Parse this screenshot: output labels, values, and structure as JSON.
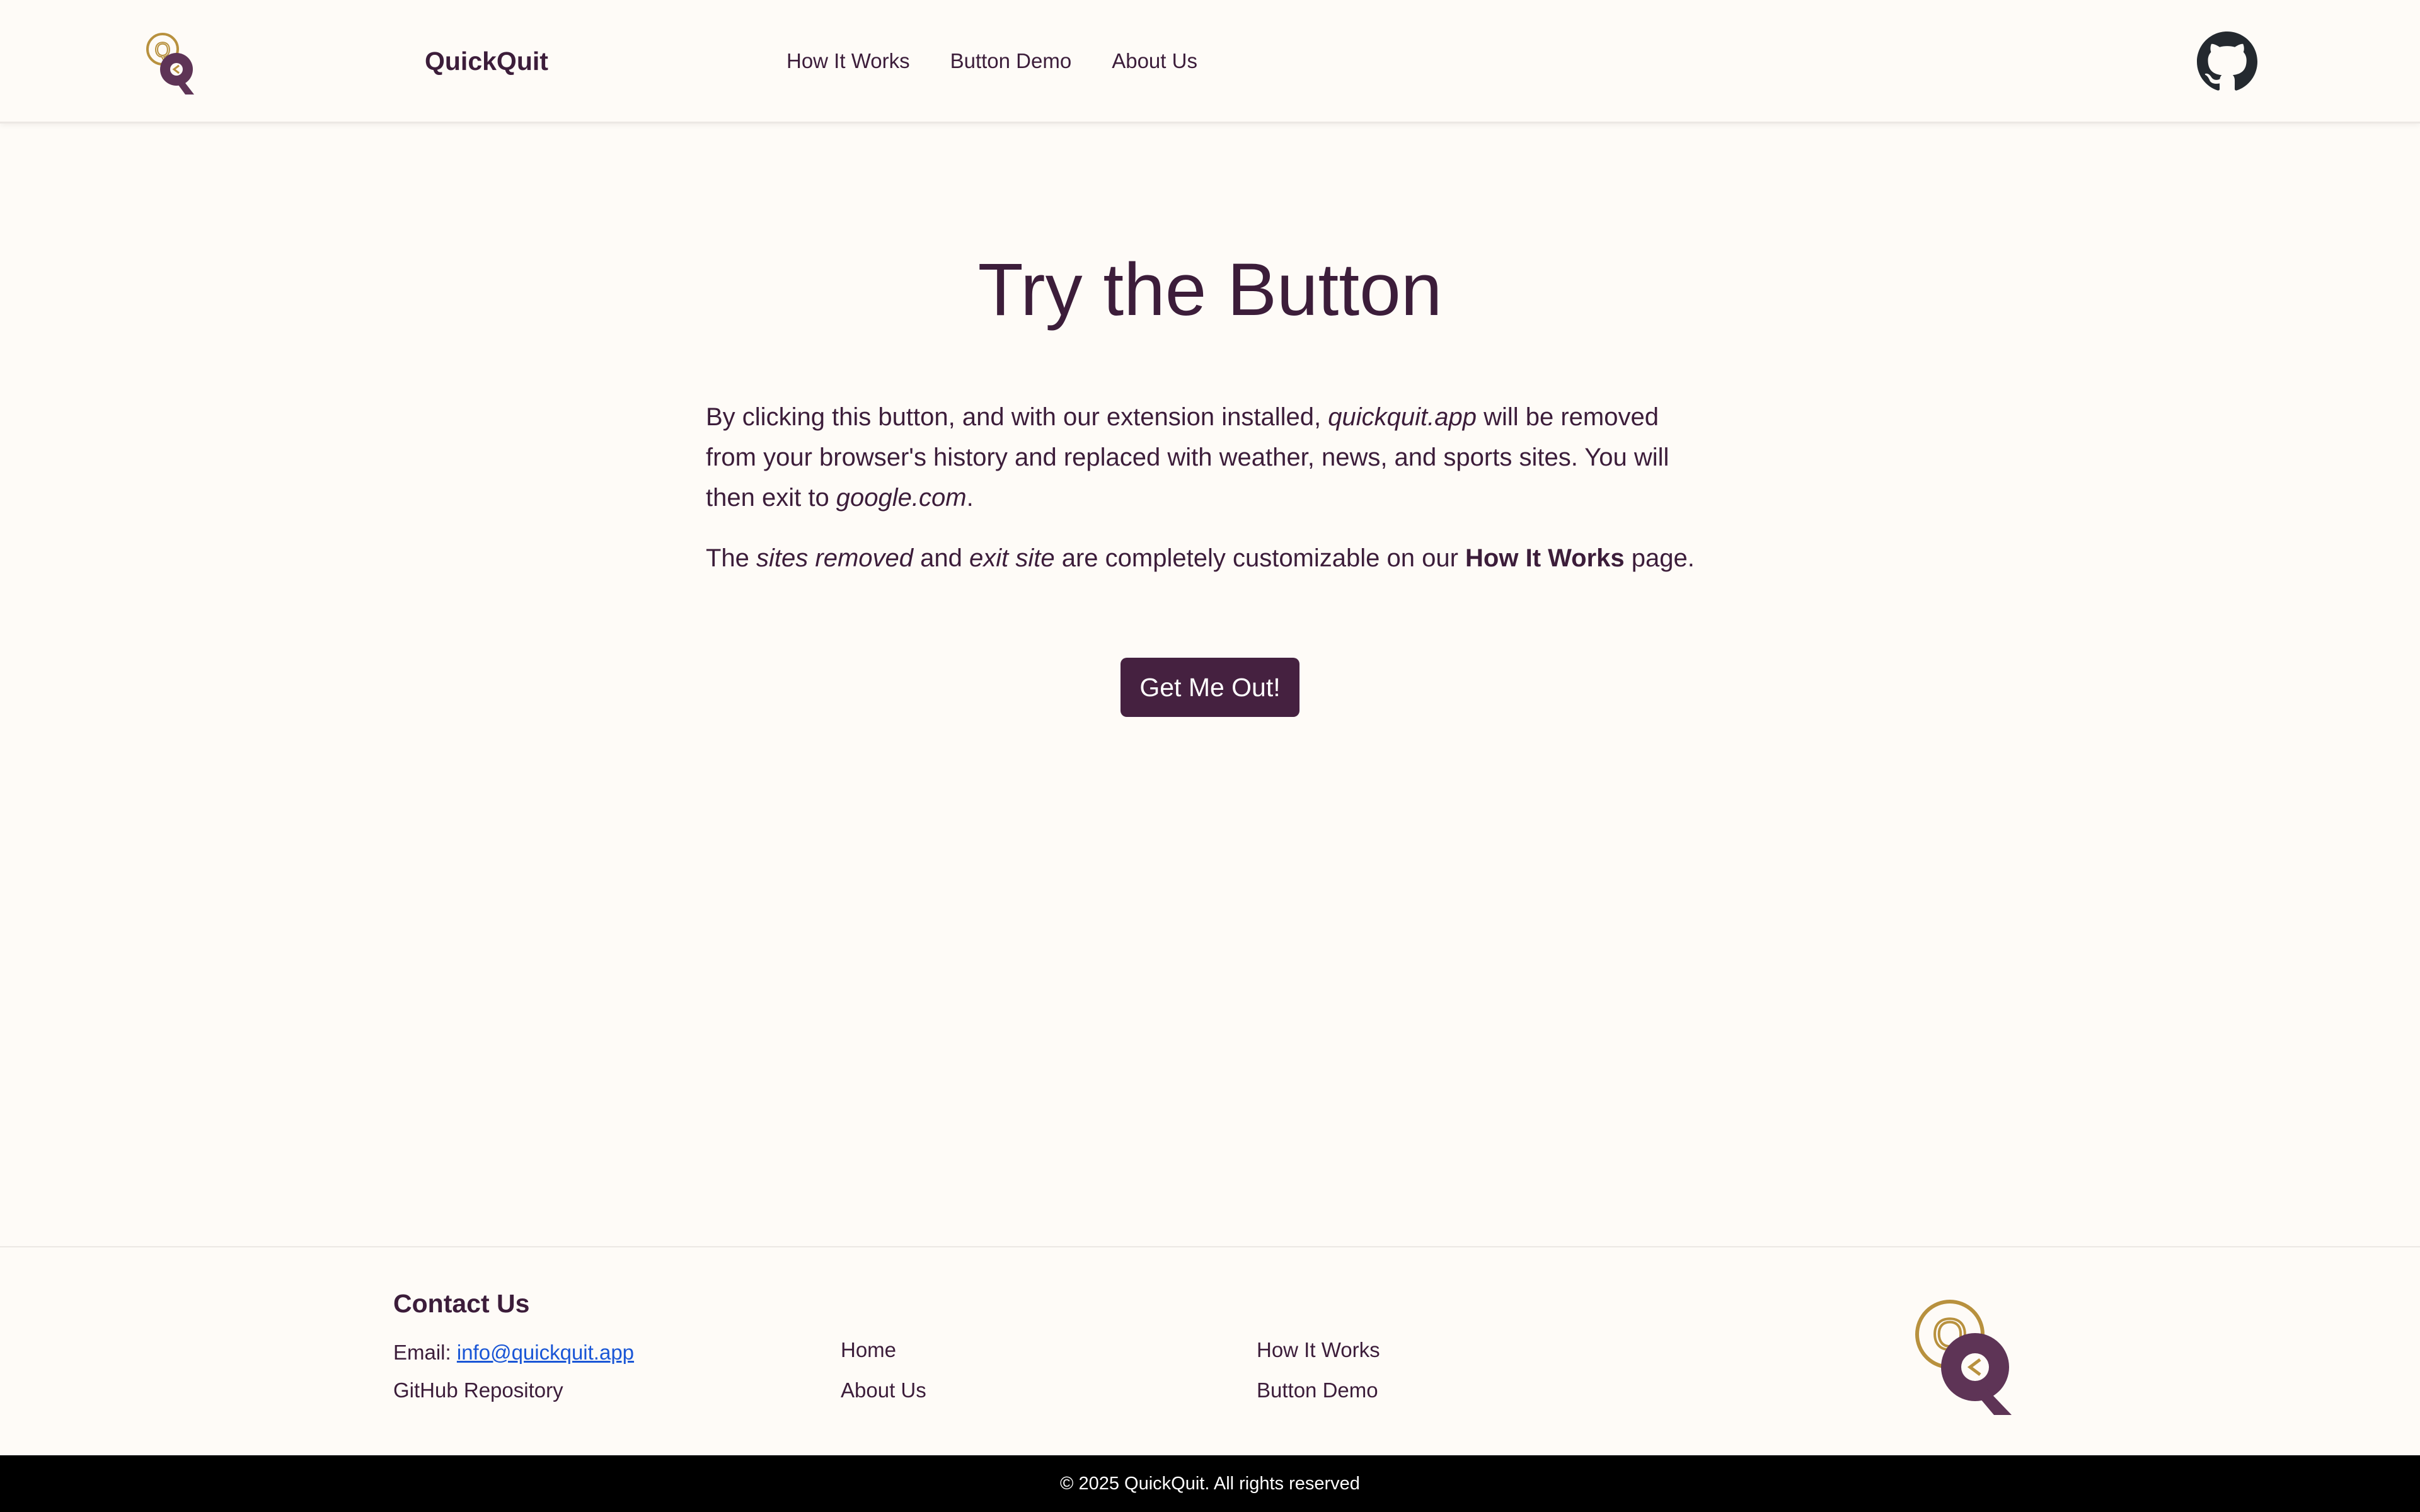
{
  "header": {
    "brand": "QuickQuit",
    "nav": {
      "how_it_works": "How It Works",
      "button_demo": "Button Demo",
      "about_us": "About Us"
    }
  },
  "main": {
    "title": "Try the Button",
    "p1": {
      "a": "By clicking this button, and with our extension installed, ",
      "b": "quickquit.app",
      "c": " will be removed from your browser's history and replaced with weather, news, and sports sites. You will then exit to ",
      "d": "google.com",
      "e": "."
    },
    "p2": {
      "a": "The ",
      "b": "sites removed",
      "c": " and ",
      "d": "exit site",
      "e": " are completely customizable on our ",
      "f": "How It Works",
      "g": " page."
    },
    "cta_label": "Get Me Out!"
  },
  "footer": {
    "contact_title": "Contact Us",
    "email_label": "Email: ",
    "email": "info@quickquit.app",
    "github": "GitHub Repository",
    "links": {
      "home": "Home",
      "about_us": "About Us",
      "how_it_works": "How It Works",
      "button_demo": "Button Demo"
    },
    "copyright": "© 2025 QuickQuit. All rights reserved"
  },
  "icons": {
    "logo": "quickquit-logo-icon",
    "github": "github-icon"
  },
  "colors": {
    "primary": "#452140",
    "text": "#3c1d3a",
    "gold": "#b8913e",
    "background": "#fefbf7",
    "link": "#1a56d6"
  }
}
